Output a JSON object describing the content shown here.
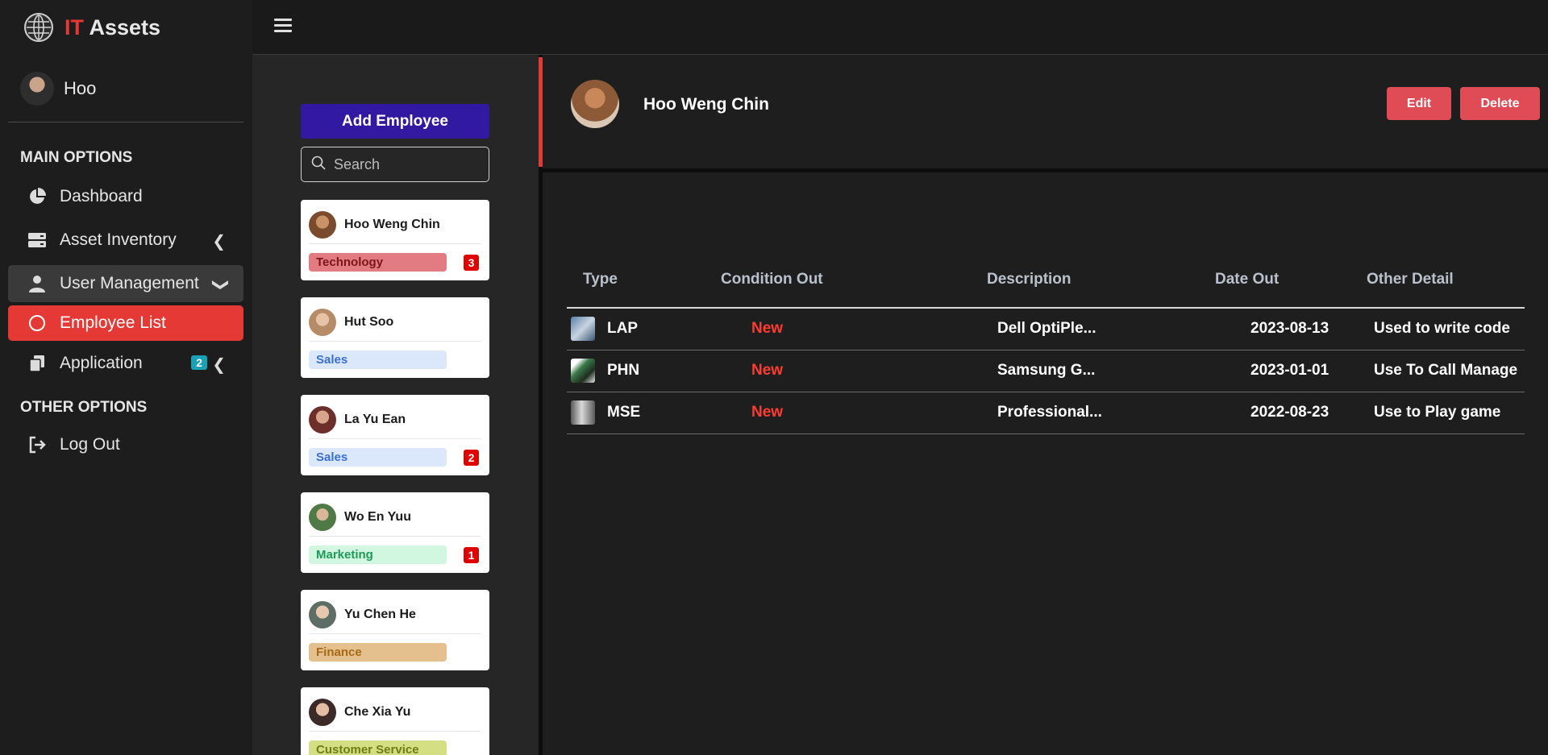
{
  "app": {
    "brand_it": "IT",
    "brand_assets": "Assets"
  },
  "sidebar": {
    "user_name": "Hoo",
    "main_header": "MAIN OPTIONS",
    "other_header": "OTHER OPTIONS",
    "items": [
      {
        "label": "Dashboard",
        "icon": "pie-chart-icon"
      },
      {
        "label": "Asset Inventory",
        "icon": "server-icon"
      },
      {
        "label": "User Management",
        "icon": "user-icon"
      },
      {
        "label": "Employee List",
        "icon": "circle-icon"
      },
      {
        "label": "Application",
        "icon": "copy-icon",
        "badge": "2"
      },
      {
        "label": "Log Out",
        "icon": "logout-icon"
      }
    ]
  },
  "list": {
    "add_button": "Add Employee",
    "search_placeholder": "Search",
    "employees": [
      {
        "name": "Hoo Weng Chin",
        "dept": "Technology",
        "count": "3"
      },
      {
        "name": "Hut Soo",
        "dept": "Sales"
      },
      {
        "name": "La Yu Ean",
        "dept": "Sales",
        "count": "2"
      },
      {
        "name": "Wo En Yuu",
        "dept": "Marketing",
        "count": "1"
      },
      {
        "name": "Yu Chen He",
        "dept": "Finance"
      },
      {
        "name": "Che Xia Yu",
        "dept": "Customer Service"
      }
    ]
  },
  "detail": {
    "name": "Hoo Weng Chin",
    "edit_label": "Edit",
    "delete_label": "Delete",
    "columns": [
      "Type",
      "Condition Out",
      "Description",
      "Date Out",
      "Other Detail"
    ],
    "rows": [
      {
        "type": "LAP",
        "condition": "New",
        "description": "Dell OptiPle...",
        "date": "2023-08-13",
        "detail": "Used to write code"
      },
      {
        "type": "PHN",
        "condition": "New",
        "description": "Samsung G...",
        "date": "2023-01-01",
        "detail": "Use To Call Manage"
      },
      {
        "type": "MSE",
        "condition": "New",
        "description": "Professional...",
        "date": "2022-08-23",
        "detail": "Use to Play game"
      }
    ]
  },
  "colors": {
    "accent_red": "#e53935",
    "add_button": "#3119a1",
    "badge_teal": "#17a2b8",
    "dept_technology": "#e27b82",
    "dept_sales": "#dbe8fc",
    "dept_marketing": "#d2f7e1",
    "dept_finance": "#e3c08d",
    "dept_customer_service": "#d4df84"
  }
}
